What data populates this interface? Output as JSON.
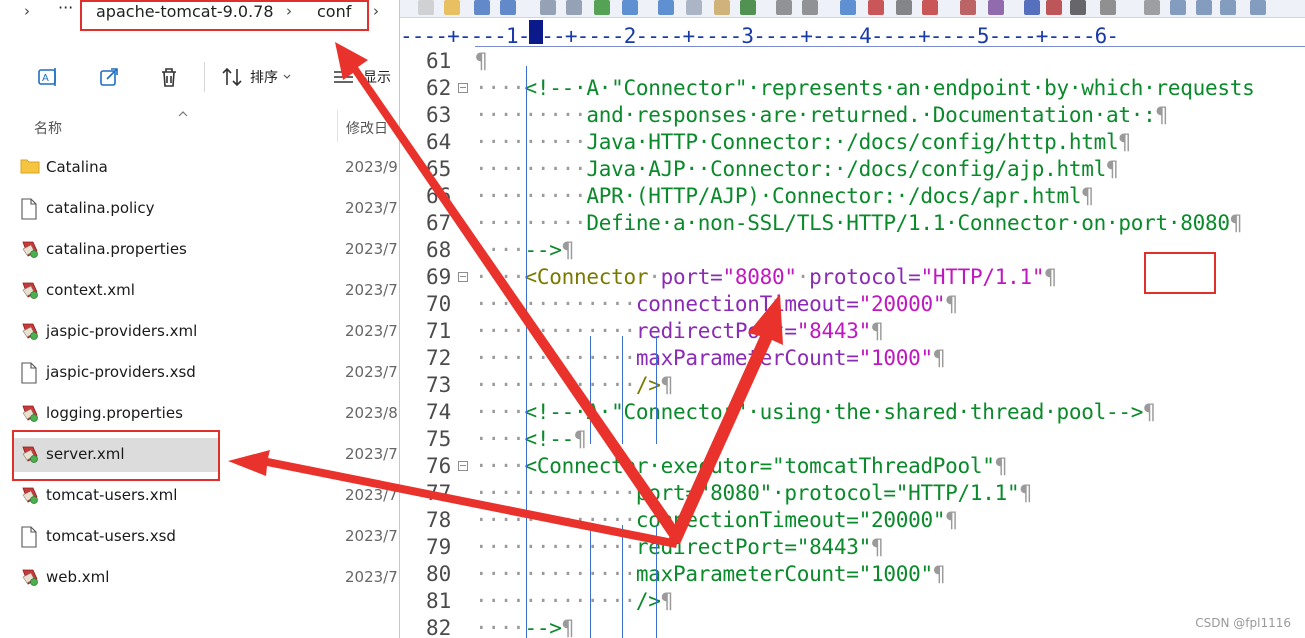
{
  "explorer": {
    "breadcrumb": {
      "back": "›",
      "more": "···",
      "segment1": "apache-tomcat-9.0.78",
      "sep1": "›",
      "segment2": "conf",
      "sep2": "›"
    },
    "commands": {
      "sort_label": "排序",
      "view_label": "显示"
    },
    "columns": {
      "name": "名称",
      "modified": "修改日"
    },
    "files": [
      {
        "name": "Catalina",
        "date": "2023/9",
        "type": "folder"
      },
      {
        "name": "catalina.policy",
        "date": "2023/7,",
        "type": "doc"
      },
      {
        "name": "catalina.properties",
        "date": "2023/7,",
        "type": "properties"
      },
      {
        "name": "context.xml",
        "date": "2023/7,",
        "type": "xml"
      },
      {
        "name": "jaspic-providers.xml",
        "date": "2023/7,",
        "type": "xml"
      },
      {
        "name": "jaspic-providers.xsd",
        "date": "2023/7,",
        "type": "doc"
      },
      {
        "name": "logging.properties",
        "date": "2023/8",
        "type": "properties"
      },
      {
        "name": "server.xml",
        "date": "2023/7,",
        "type": "xml",
        "selected": true
      },
      {
        "name": "tomcat-users.xml",
        "date": "2023/7,",
        "type": "xml"
      },
      {
        "name": "tomcat-users.xsd",
        "date": "2023/7,",
        "type": "doc"
      },
      {
        "name": "web.xml",
        "date": "2023/7,",
        "type": "xml"
      }
    ]
  },
  "editor": {
    "ruler": "----+----1----+----2----+----3----+----4----+----5----+----6-",
    "watermark": "CSDN @fpl1116",
    "lines": [
      {
        "n": "61",
        "parts": [
          {
            "t": "¶",
            "c": "ws"
          }
        ]
      },
      {
        "n": "62",
        "fold": true,
        "parts": [
          {
            "t": "····",
            "c": "ws"
          },
          {
            "t": "<!--·A·\"Connector\"·represents·an·endpoint·by·which·requests",
            "c": "cm"
          }
        ]
      },
      {
        "n": "63",
        "parts": [
          {
            "t": "·········",
            "c": "ws"
          },
          {
            "t": "and·responses·are·returned.·Documentation·at·:",
            "c": "cm"
          },
          {
            "t": "¶",
            "c": "ws"
          }
        ]
      },
      {
        "n": "64",
        "parts": [
          {
            "t": "·········",
            "c": "ws"
          },
          {
            "t": "Java·HTTP·Connector:·/docs/config/http.html",
            "c": "cm"
          },
          {
            "t": "¶",
            "c": "ws"
          }
        ]
      },
      {
        "n": "65",
        "parts": [
          {
            "t": "·········",
            "c": "ws"
          },
          {
            "t": "Java·AJP··Connector:·/docs/config/ajp.html",
            "c": "cm"
          },
          {
            "t": "¶",
            "c": "ws"
          }
        ]
      },
      {
        "n": "66",
        "parts": [
          {
            "t": "·········",
            "c": "ws"
          },
          {
            "t": "APR·(HTTP/AJP)·Connector:·/docs/apr.html",
            "c": "cm"
          },
          {
            "t": "¶",
            "c": "ws"
          }
        ]
      },
      {
        "n": "67",
        "parts": [
          {
            "t": "·········",
            "c": "ws"
          },
          {
            "t": "Define·a·non-SSL/TLS·HTTP/1.1·Connector·on·port·8080",
            "c": "cm"
          },
          {
            "t": "¶",
            "c": "ws"
          }
        ]
      },
      {
        "n": "68",
        "parts": [
          {
            "t": "····",
            "c": "ws"
          },
          {
            "t": "-->",
            "c": "cm"
          },
          {
            "t": "¶",
            "c": "ws"
          }
        ]
      },
      {
        "n": "69",
        "fold": true,
        "parts": [
          {
            "t": "····",
            "c": "ws"
          },
          {
            "t": "<Connector",
            "c": "tag"
          },
          {
            "t": "·",
            "c": "ws"
          },
          {
            "t": "port=",
            "c": "at"
          },
          {
            "t": "\"8080\"",
            "c": "av"
          },
          {
            "t": "·",
            "c": "ws"
          },
          {
            "t": "protocol=",
            "c": "at"
          },
          {
            "t": "\"HTTP/1.1\"",
            "c": "av"
          },
          {
            "t": "¶",
            "c": "ws"
          }
        ]
      },
      {
        "n": "70",
        "parts": [
          {
            "t": "·············",
            "c": "ws"
          },
          {
            "t": "connectionTimeout=",
            "c": "at"
          },
          {
            "t": "\"20000\"",
            "c": "av"
          },
          {
            "t": "¶",
            "c": "ws"
          }
        ]
      },
      {
        "n": "71",
        "parts": [
          {
            "t": "·············",
            "c": "ws"
          },
          {
            "t": "redirectPort=",
            "c": "at"
          },
          {
            "t": "\"8443\"",
            "c": "av"
          },
          {
            "t": "¶",
            "c": "ws"
          }
        ]
      },
      {
        "n": "72",
        "parts": [
          {
            "t": "·············",
            "c": "ws"
          },
          {
            "t": "maxParameterCount=",
            "c": "at"
          },
          {
            "t": "\"1000\"",
            "c": "av"
          },
          {
            "t": "¶",
            "c": "ws"
          }
        ]
      },
      {
        "n": "73",
        "parts": [
          {
            "t": "·············",
            "c": "ws"
          },
          {
            "t": "/>",
            "c": "tag"
          },
          {
            "t": "¶",
            "c": "ws"
          }
        ]
      },
      {
        "n": "74",
        "parts": [
          {
            "t": "····",
            "c": "ws"
          },
          {
            "t": "<!--·A·\"Connector\"·using·the·shared·thread·pool-->",
            "c": "cm"
          },
          {
            "t": "¶",
            "c": "ws"
          }
        ]
      },
      {
        "n": "75",
        "parts": [
          {
            "t": "····",
            "c": "ws"
          },
          {
            "t": "<!--",
            "c": "cm"
          },
          {
            "t": "¶",
            "c": "ws"
          }
        ]
      },
      {
        "n": "76",
        "fold": true,
        "parts": [
          {
            "t": "····",
            "c": "ws"
          },
          {
            "t": "<Connector·executor=\"tomcatThreadPool\"",
            "c": "tg"
          },
          {
            "t": "¶",
            "c": "ws"
          }
        ]
      },
      {
        "n": "77",
        "parts": [
          {
            "t": "·············",
            "c": "ws"
          },
          {
            "t": "port=\"8080\"·protocol=\"HTTP/1.1\"",
            "c": "tg"
          },
          {
            "t": "¶",
            "c": "ws"
          }
        ]
      },
      {
        "n": "78",
        "parts": [
          {
            "t": "·············",
            "c": "ws"
          },
          {
            "t": "connectionTimeout=\"20000\"",
            "c": "tg"
          },
          {
            "t": "¶",
            "c": "ws"
          }
        ]
      },
      {
        "n": "79",
        "parts": [
          {
            "t": "·············",
            "c": "ws"
          },
          {
            "t": "redirectPort=\"8443\"",
            "c": "tg"
          },
          {
            "t": "¶",
            "c": "ws"
          }
        ]
      },
      {
        "n": "80",
        "parts": [
          {
            "t": "·············",
            "c": "ws"
          },
          {
            "t": "maxParameterCount=\"1000\"",
            "c": "tg"
          },
          {
            "t": "¶",
            "c": "ws"
          }
        ]
      },
      {
        "n": "81",
        "parts": [
          {
            "t": "·············",
            "c": "ws"
          },
          {
            "t": "/>",
            "c": "tg"
          },
          {
            "t": "¶",
            "c": "ws"
          }
        ]
      },
      {
        "n": "82",
        "parts": [
          {
            "t": "····",
            "c": "ws"
          },
          {
            "t": "-->",
            "c": "cm"
          },
          {
            "t": "¶",
            "c": "ws"
          }
        ]
      }
    ]
  },
  "colors": {
    "annotation_red": "#e8322b",
    "comment_green": "#0a8a2a",
    "attr_purple": "#8b2bb5",
    "value_magenta": "#c018c0",
    "tag_olive": "#7a7a00",
    "indent_blue": "#3b6fd0"
  }
}
